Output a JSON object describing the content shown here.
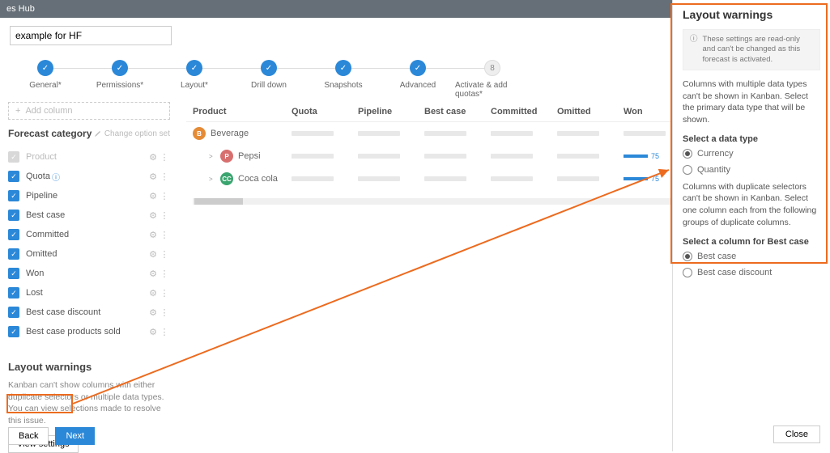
{
  "topbar": {
    "title": "es Hub"
  },
  "search": {
    "value": "example for HF"
  },
  "steps": [
    {
      "label": "General*",
      "done": true
    },
    {
      "label": "Permissions*",
      "done": true
    },
    {
      "label": "Layout*",
      "done": true
    },
    {
      "label": "Drill down",
      "done": true
    },
    {
      "label": "Snapshots",
      "done": true
    },
    {
      "label": "Advanced",
      "done": true
    },
    {
      "label": "Activate & add quotas*",
      "done": false,
      "num": "8"
    }
  ],
  "addColumn": "Add column",
  "forecastCategory": {
    "title": "Forecast category",
    "changeOption": "Change option set",
    "items": [
      {
        "label": "Product",
        "disabled": true
      },
      {
        "label": "Quota",
        "info": true
      },
      {
        "label": "Pipeline"
      },
      {
        "label": "Best case"
      },
      {
        "label": "Committed"
      },
      {
        "label": "Omitted"
      },
      {
        "label": "Won"
      },
      {
        "label": "Lost"
      },
      {
        "label": "Best case discount"
      },
      {
        "label": "Best case products sold"
      }
    ]
  },
  "layoutWarningsLeft": {
    "title": "Layout warnings",
    "body": "Kanban can't show columns with either duplicate selectors or multiple data types. You can view selections made to resolve this issue.",
    "button": "View settings"
  },
  "nav": {
    "back": "Back",
    "next": "Next"
  },
  "table": {
    "headers": [
      "Product",
      "Quota",
      "Pipeline",
      "Best case",
      "Committed",
      "Omitted",
      "Won"
    ],
    "rows": [
      {
        "label": "Beverage",
        "badge": "B",
        "color": "#e58b36",
        "indent": 0,
        "exp": "",
        "won": ""
      },
      {
        "label": "Pepsi",
        "badge": "P",
        "color": "#d86f6f",
        "indent": 1,
        "exp": ">",
        "won": "75"
      },
      {
        "label": "Coca cola",
        "badge": "CC",
        "color": "#3aa56f",
        "indent": 1,
        "exp": ">",
        "won": "75"
      }
    ]
  },
  "rpanel": {
    "title": "Layout warnings",
    "info": "These settings are read-only and can't be changed as this forecast is activated.",
    "p1": "Columns with multiple data types can't be shown in Kanban. Select the primary data type that will be shown.",
    "sel1_label": "Select a data type",
    "sel1_options": [
      "Currency",
      "Quantity"
    ],
    "p2": "Columns with duplicate selectors can't be shown in Kanban. Select one column each from the following groups of duplicate columns.",
    "sel2_label": "Select a column for Best case",
    "sel2_options": [
      "Best case",
      "Best case discount"
    ],
    "close": "Close"
  }
}
